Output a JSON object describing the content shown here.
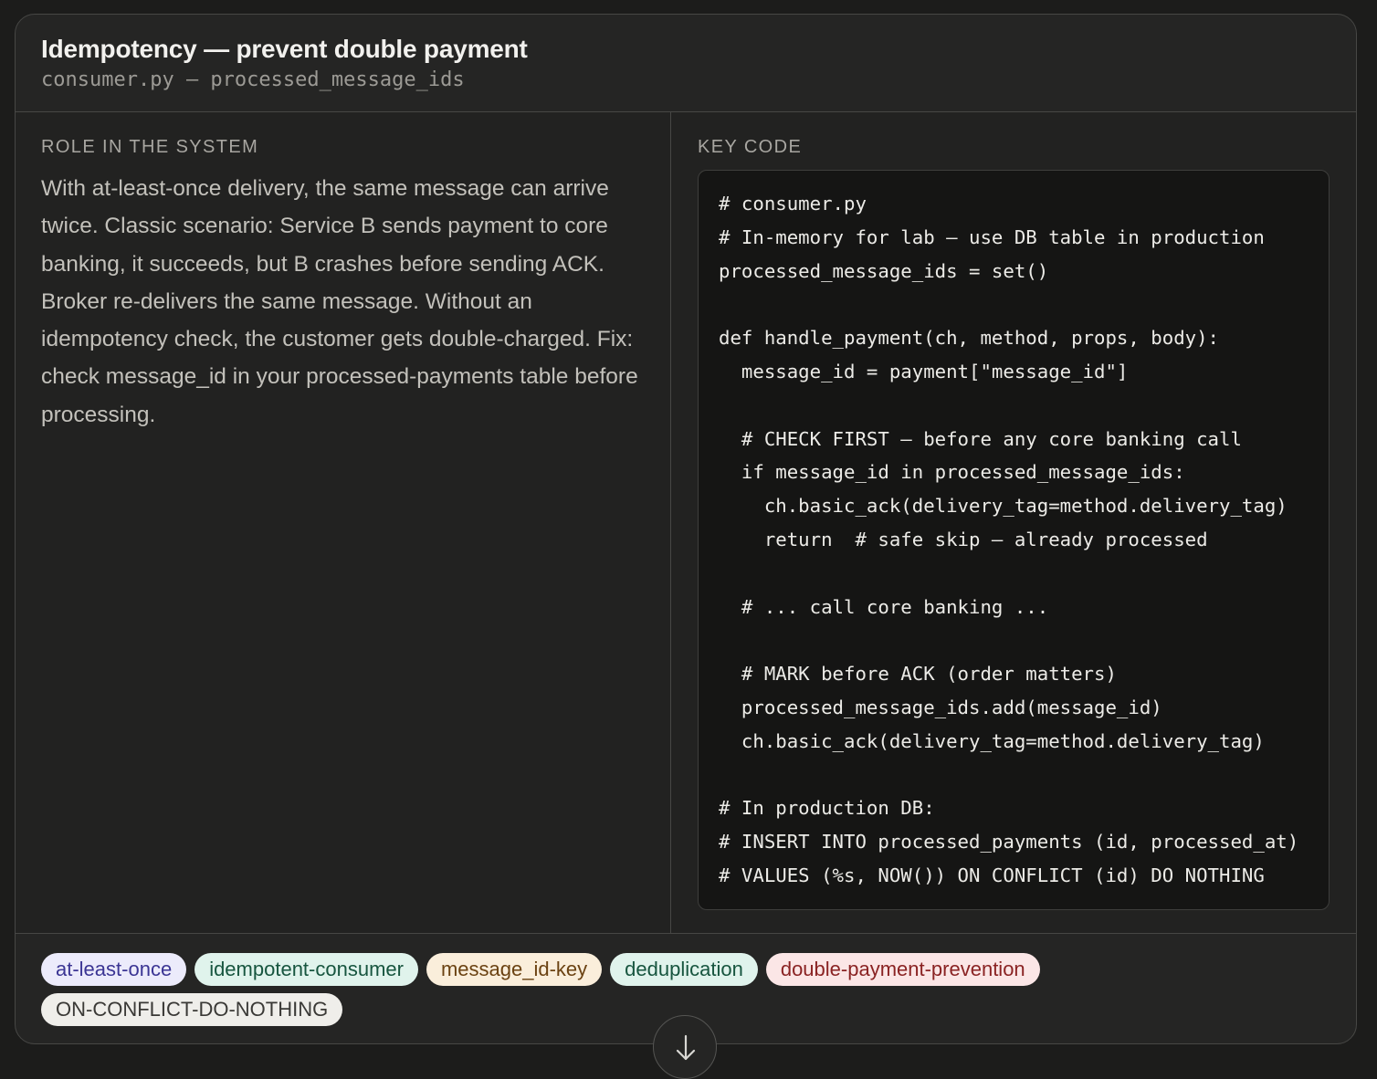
{
  "card": {
    "title": "Idempotency — prevent double payment",
    "subtitle": "consumer.py — processed_message_ids"
  },
  "role": {
    "label": "ROLE IN THE SYSTEM",
    "text": "With at-least-once delivery, the same message can arrive twice. Classic scenario: Service B sends payment to core banking, it succeeds, but B crashes before sending ACK. Broker re-delivers the same message. Without an idempotency check, the customer gets double-charged. Fix: check message_id in your processed-payments table before processing."
  },
  "key_code": {
    "label": "KEY CODE",
    "code": "# consumer.py\n# In-memory for lab — use DB table in production\nprocessed_message_ids = set()\n\ndef handle_payment(ch, method, props, body):\n  message_id = payment[\"message_id\"]\n\n  # CHECK FIRST — before any core banking call\n  if message_id in processed_message_ids:\n    ch.basic_ack(delivery_tag=method.delivery_tag)\n    return  # safe skip — already processed\n\n  # ... call core banking ...\n\n  # MARK before ACK (order matters)\n  processed_message_ids.add(message_id)\n  ch.basic_ack(delivery_tag=method.delivery_tag)\n\n# In production DB:\n# INSERT INTO processed_payments (id, processed_at)\n# VALUES (%s, NOW()) ON CONFLICT (id) DO NOTHING"
  },
  "tags": [
    "at-least-once",
    "idempotent-consumer",
    "message_id-key",
    "deduplication",
    "double-payment-prevention",
    "ON-CONFLICT-DO-NOTHING"
  ],
  "scroll_button": {
    "icon": "arrow-down-icon"
  }
}
